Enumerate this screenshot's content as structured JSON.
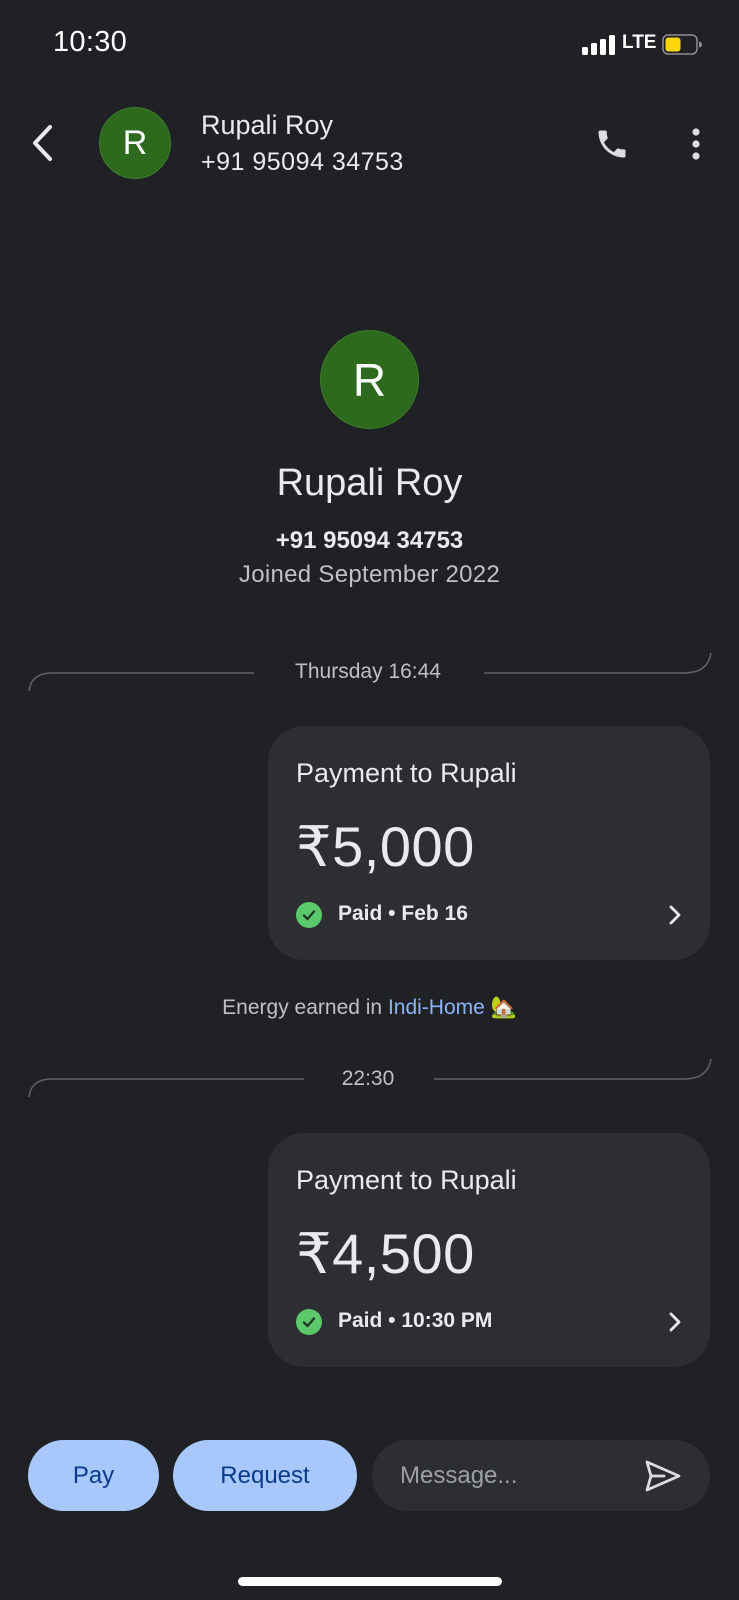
{
  "status_bar": {
    "time": "10:30",
    "network": "LTE",
    "battery_color": "#ffd60a"
  },
  "header": {
    "back_icon": "chevron-left-icon",
    "avatar_initial": "R",
    "avatar_color": "#2e6a1e",
    "name": "Rupali Roy",
    "phone": "+91 95094 34753",
    "call_icon": "phone-icon",
    "more_icon": "more-vert-icon"
  },
  "profile": {
    "avatar_initial": "R",
    "name": "Rupali Roy",
    "phone": "+91 95094 34753",
    "joined": "Joined September 2022"
  },
  "conversation": {
    "separators": [
      "Thursday 16:44",
      "22:30"
    ],
    "payments": [
      {
        "title": "Payment to Rupali",
        "amount": "₹5,000",
        "status": "Paid • Feb 16"
      },
      {
        "title": "Payment to Rupali",
        "amount": "₹4,500",
        "status": "Paid • 10:30 PM"
      }
    ],
    "energy": {
      "prefix": "Energy earned in ",
      "link": "Indi-Home",
      "emoji": "🏡"
    }
  },
  "bottom_bar": {
    "pay_label": "Pay",
    "request_label": "Request",
    "message_placeholder": "Message...",
    "send_icon": "send-icon"
  },
  "colors": {
    "background": "#202124",
    "card": "#2d2e31",
    "button": "#a8c7fa",
    "success": "#5bc96b",
    "link": "#8ab4f8"
  }
}
